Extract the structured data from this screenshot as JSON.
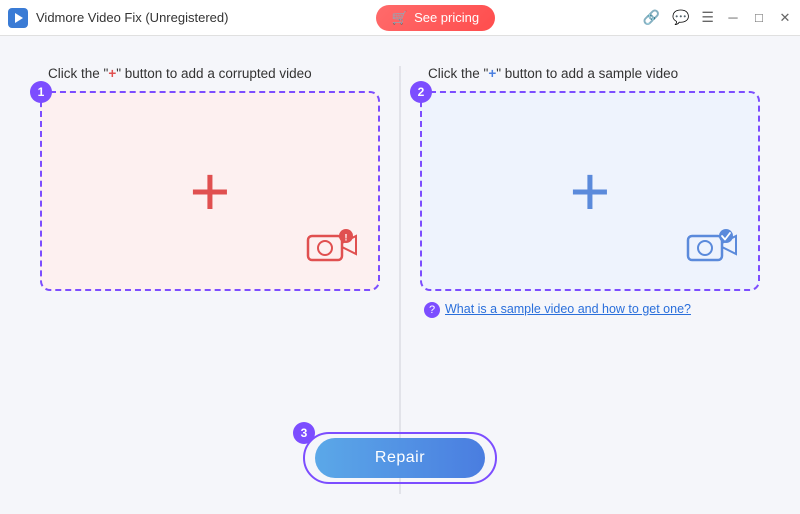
{
  "titleBar": {
    "appName": "Vidmore Video Fix (Unregistered)",
    "pricingBtn": "See pricing",
    "icons": {
      "link": "🔗",
      "chat": "💬",
      "menu": "☰",
      "minimize": "─",
      "maximize": "□",
      "close": "✕"
    }
  },
  "leftPanel": {
    "badgeNum": "1",
    "title_pre": "Click the \"",
    "title_plus": "+",
    "title_post": "\" button to add a corrupted video"
  },
  "rightPanel": {
    "badgeNum": "2",
    "title_pre": "Click the \"",
    "title_plus": "+",
    "title_post": "\" button to add a sample video",
    "infoText": "What is a sample video and how to get one?"
  },
  "repairArea": {
    "badgeNum": "3",
    "btnLabel": "Repair"
  }
}
